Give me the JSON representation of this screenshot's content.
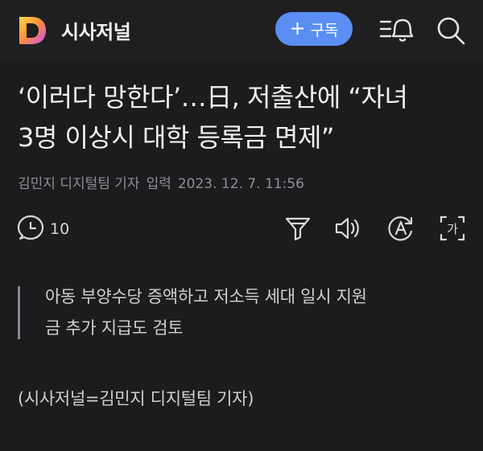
{
  "header": {
    "brand_name": "시사저널",
    "subscribe_label": "구독",
    "subscribe_plus": "+",
    "logo_letter": "D"
  },
  "article": {
    "title_line1": "‘이러다 망한다’…日, 저출산에 “자녀",
    "title_line2": "3명 이상시 대학 등록금 면제”",
    "reporter": "김민지 디지털팀 기자",
    "input_label": "입력",
    "date": "2023. 12. 7. 11:56",
    "subheading_line1": "아동 부양수당 증액하고 저소득 세대 일시 지원",
    "subheading_line2": "금 추가 지급도 검토",
    "body_first_line": "(시사저널=김민지 디지털팀 기자)"
  },
  "toolbar": {
    "comment_count": "10",
    "translate_label": "가"
  },
  "colors": {
    "background": "#1c1c1e",
    "accent": "#5a8ef2",
    "text": "#f0f0f0",
    "meta": "#8e8e93"
  }
}
